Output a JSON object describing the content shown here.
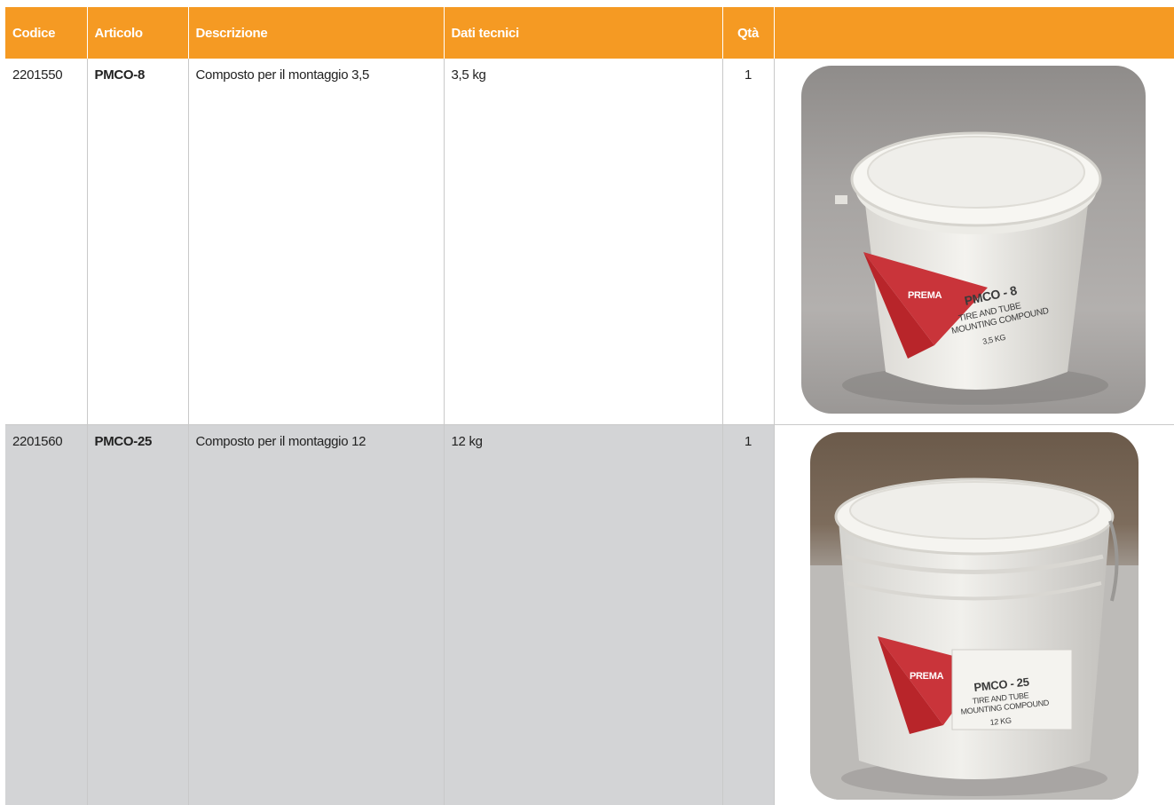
{
  "columns": {
    "codice": "Codice",
    "articolo": "Articolo",
    "descrizione": "Descrizione",
    "dati_tecnici": "Dati tecnici",
    "qta": "Qtà"
  },
  "rows": [
    {
      "codice": "2201550",
      "articolo": "PMCO-8",
      "descrizione": "Composto per il montaggio 3,5",
      "dati_tecnici": "3,5 kg",
      "qta": "1",
      "label": {
        "brand": "PREMA",
        "line1": "PMCO - 8",
        "line2": "TIRE AND TUBE",
        "line3": "MOUNTING COMPOUND",
        "line4": "3,5 KG"
      }
    },
    {
      "codice": "2201560",
      "articolo": "PMCO-25",
      "descrizione": "Composto per il montaggio 12",
      "dati_tecnici": "12 kg",
      "qta": "1",
      "label": {
        "brand": "PREMA",
        "line1": "PMCO - 25",
        "line2": "TIRE AND TUBE",
        "line3": "MOUNTING COMPOUND",
        "line4": "12 KG"
      }
    }
  ],
  "colors": {
    "header_bg": "#f59a23",
    "header_text": "#ffffff",
    "row_alt_bg": "#d3d4d6",
    "grid_line": "#c9c9c9",
    "label_red": "#b8252a"
  }
}
